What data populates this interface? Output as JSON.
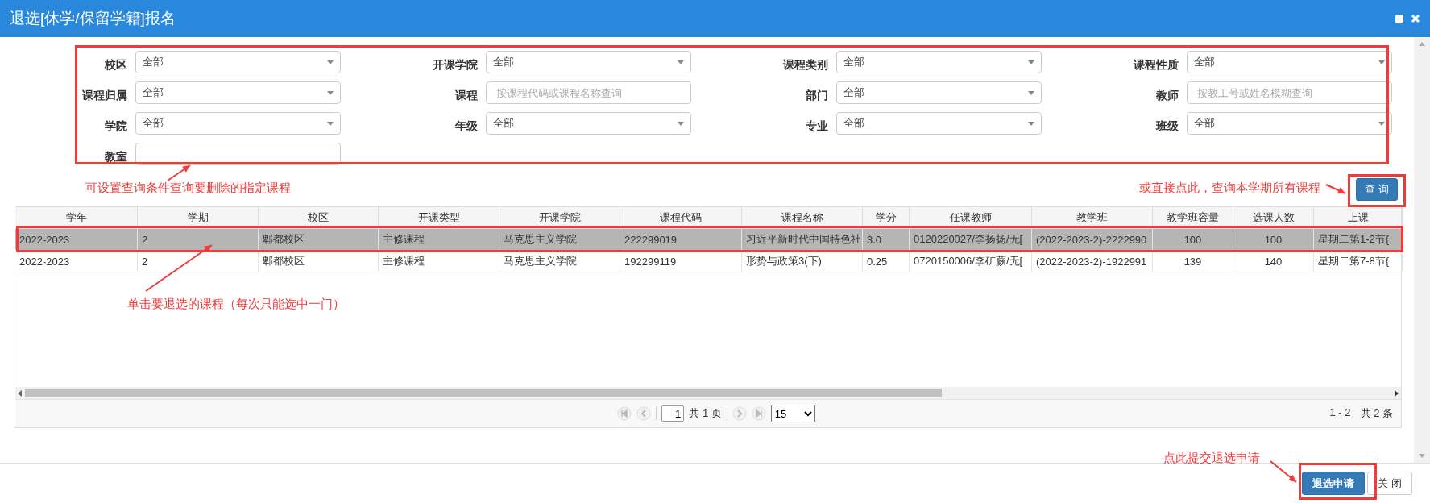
{
  "window": {
    "title": "退选[休学/保留学籍]报名"
  },
  "filters": [
    {
      "label": "校区",
      "kind": "select",
      "value": "全部"
    },
    {
      "label": "开课学院",
      "kind": "select",
      "value": "全部"
    },
    {
      "label": "课程类别",
      "kind": "select",
      "value": "全部"
    },
    {
      "label": "课程性质",
      "kind": "select",
      "value": "全部"
    },
    {
      "label": "课程归属",
      "kind": "select",
      "value": "全部"
    },
    {
      "label": "课程",
      "kind": "text",
      "placeholder": "按课程代码或课程名称查询"
    },
    {
      "label": "部门",
      "kind": "select",
      "value": "全部"
    },
    {
      "label": "教师",
      "kind": "text",
      "placeholder": "按教工号或姓名模糊查询"
    },
    {
      "label": "学院",
      "kind": "select",
      "value": "全部"
    },
    {
      "label": "年级",
      "kind": "select",
      "value": "全部"
    },
    {
      "label": "专业",
      "kind": "select",
      "value": "全部"
    },
    {
      "label": "班级",
      "kind": "select",
      "value": "全部"
    },
    {
      "label": "教室",
      "kind": "text"
    }
  ],
  "filters_note": "可设置查询条件查询要删除的指定课程",
  "query_note": "或直接点此，查询本学期所有课程",
  "query_button": "查 询",
  "table": {
    "columns": [
      {
        "label": "学年",
        "kind": "text"
      },
      {
        "label": "学期",
        "kind": "text"
      },
      {
        "label": "校区",
        "kind": "text"
      },
      {
        "label": "开课类型",
        "kind": "text"
      },
      {
        "label": "开课学院",
        "kind": "text"
      },
      {
        "label": "课程代码",
        "kind": "text"
      },
      {
        "label": "课程名称",
        "kind": "text"
      },
      {
        "label": "学分",
        "kind": "text"
      },
      {
        "label": "任课教师",
        "kind": "text"
      },
      {
        "label": "教学班",
        "kind": "text"
      },
      {
        "label": "教学班容量",
        "kind": "count"
      },
      {
        "label": "选课人数",
        "kind": "count"
      },
      {
        "label": "上课",
        "kind": "text"
      }
    ],
    "rows": [
      {
        "selected": true,
        "cells": [
          "2022-2023",
          "2",
          "郫都校区",
          "主修课程",
          "马克思主义学院",
          "222299019",
          "习近平新时代中国特色社",
          "3.0",
          "0120220027/李扬扬/无[",
          "(2022-2023-2)-2222990",
          "100",
          "100",
          "星期二第1-2节{"
        ]
      },
      {
        "selected": false,
        "cells": [
          "2022-2023",
          "2",
          "郫都校区",
          "主修课程",
          "马克思主义学院",
          "192299119",
          "形势与政策3(下)",
          "0.25",
          "0720150006/李矿蕨/无[",
          "(2022-2023-2)-1922991",
          "139",
          "140",
          "星期二第7-8节{"
        ]
      }
    ]
  },
  "table_note": "单击要退选的课程（每次只能选中一门）",
  "pager": {
    "page": "1",
    "total_pages": "共 1 页",
    "page_size": "15",
    "range": "1 - 2",
    "total": "共 2 条"
  },
  "submit_note": "点此提交退选申请",
  "footer_buttons": [
    {
      "label": "退选申请",
      "kind": "primary"
    },
    {
      "label": "关 闭",
      "kind": "default"
    }
  ]
}
